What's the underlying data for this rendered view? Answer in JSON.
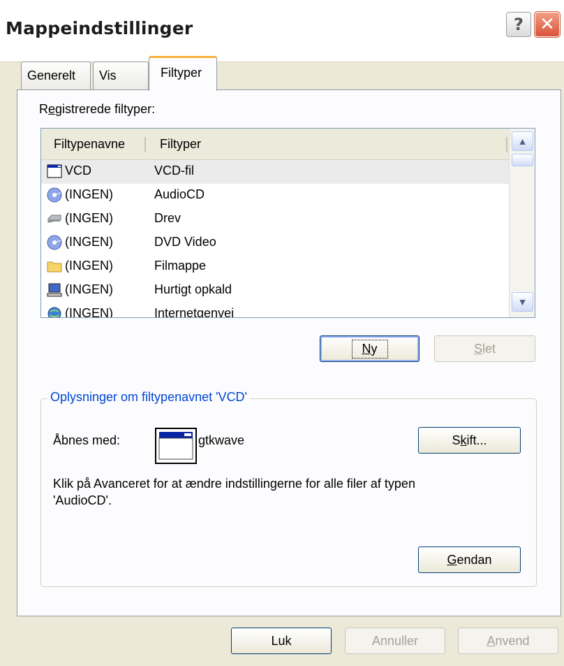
{
  "title": "Mappeindstillinger",
  "titlebar_buttons": {
    "help": "?",
    "close": "✕"
  },
  "tabs": [
    {
      "label": "Generelt",
      "active": false
    },
    {
      "label": "Vis",
      "active": false
    },
    {
      "label": "Filtyper",
      "active": true
    }
  ],
  "registered_label_prefix": "R",
  "registered_label_accel": "e",
  "registered_label_rest": "gistrerede filtyper:",
  "list": {
    "columns": [
      "Filtypenavne",
      "Filtyper"
    ],
    "rows": [
      {
        "icon": "window-icon",
        "ext": "VCD",
        "type": "VCD-fil",
        "selected": true
      },
      {
        "icon": "cd-icon",
        "ext": "(INGEN)",
        "type": "AudioCD"
      },
      {
        "icon": "drive-icon",
        "ext": "(INGEN)",
        "type": "Drev"
      },
      {
        "icon": "cd-icon",
        "ext": "(INGEN)",
        "type": "DVD Video"
      },
      {
        "icon": "folder-icon",
        "ext": "(INGEN)",
        "type": "Filmappe"
      },
      {
        "icon": "computer-icon",
        "ext": "(INGEN)",
        "type": "Hurtigt opkald"
      },
      {
        "icon": "globe-icon",
        "ext": "(INGEN)",
        "type": "Internetgenvej"
      }
    ]
  },
  "buttons": {
    "new": {
      "accel": "N",
      "rest": "y"
    },
    "delete": {
      "accel": "S",
      "rest": "let"
    },
    "change": {
      "pre": "S",
      "accel": "k",
      "rest": "ift..."
    },
    "restore": {
      "accel": "G",
      "rest": "endan"
    },
    "close": "Luk",
    "cancel": "Annuller",
    "apply": {
      "accel": "A",
      "rest": "nvend"
    }
  },
  "details": {
    "group_title": "Oplysninger om filtypenavnet 'VCD'",
    "opens_with_label": "Åbnes med:",
    "program": "gtkwave",
    "info_line1": "Klik på Avanceret for at ændre indstillingerne for alle filer af typen",
    "info_line2": "'AudioCD'."
  },
  "colors": {
    "accent_tab": "#f9b038",
    "group_title": "#0046d5",
    "close_red": "#d9533b"
  }
}
